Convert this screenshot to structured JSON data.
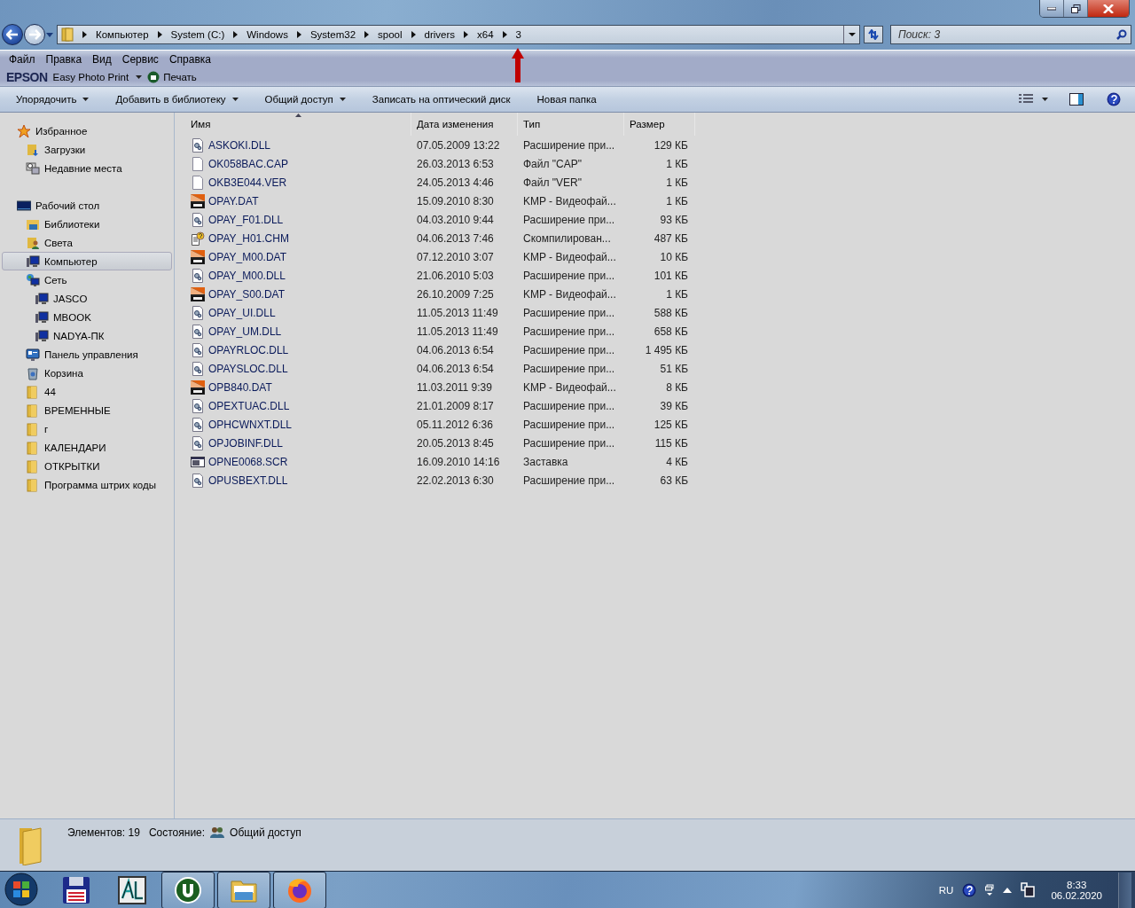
{
  "address_bar": {
    "path": [
      "Компьютер",
      "System (C:)",
      "Windows",
      "System32",
      "spool",
      "drivers",
      "x64",
      "3"
    ]
  },
  "search": {
    "placeholder": "Поиск: 3"
  },
  "menu": [
    "Файл",
    "Правка",
    "Вид",
    "Сервис",
    "Справка"
  ],
  "epson_bar": {
    "brand": "EPSON",
    "app": "Easy Photo Print",
    "print": "Печать"
  },
  "toolbar": [
    {
      "label": "Упорядочить",
      "dropdown": true
    },
    {
      "label": "Добавить в библиотеку",
      "dropdown": true
    },
    {
      "label": "Общий доступ",
      "dropdown": true
    },
    {
      "label": "Записать на оптический диск",
      "dropdown": false
    },
    {
      "label": "Новая папка",
      "dropdown": false
    }
  ],
  "sidebar": {
    "groups": [
      {
        "label": "Избранное",
        "kind": "star",
        "selected": false,
        "children": [
          {
            "label": "Загрузки",
            "kind": "downloads",
            "selected": false
          },
          {
            "label": "Недавние места",
            "kind": "recent",
            "selected": false
          }
        ]
      },
      {
        "label": "Рабочий стол",
        "kind": "desktop",
        "selected": false,
        "children": [
          {
            "label": "Библиотеки",
            "kind": "library",
            "selected": false
          },
          {
            "label": "Света",
            "kind": "user",
            "selected": false
          },
          {
            "label": "Компьютер",
            "kind": "computer",
            "selected": true
          },
          {
            "label": "Сеть",
            "kind": "network",
            "selected": false,
            "children": [
              {
                "label": "JASCO",
                "kind": "computer",
                "selected": false
              },
              {
                "label": "MBOOK",
                "kind": "computer",
                "selected": false
              },
              {
                "label": "NADYA-ПК",
                "kind": "computer",
                "selected": false
              }
            ]
          },
          {
            "label": "Панель управления",
            "kind": "control",
            "selected": false
          },
          {
            "label": "Корзина",
            "kind": "bin",
            "selected": false
          },
          {
            "label": "44",
            "kind": "folder",
            "selected": false
          },
          {
            "label": "ВРЕМЕННЫЕ",
            "kind": "folder",
            "selected": false
          },
          {
            "label": "г",
            "kind": "folder",
            "selected": false
          },
          {
            "label": "КАЛЕНДАРИ",
            "kind": "folder",
            "selected": false
          },
          {
            "label": "ОТКРЫТКИ",
            "kind": "folder",
            "selected": false
          },
          {
            "label": "Программа штрих коды",
            "kind": "folder",
            "selected": false
          }
        ]
      }
    ]
  },
  "table": {
    "columns": [
      "Имя",
      "Дата изменения",
      "Тип",
      "Размер"
    ],
    "rows": [
      {
        "kind": "dll",
        "name": "ASKOKI.DLL",
        "date": "07.05.2009 13:22",
        "type": "Расширение при...",
        "size": "129 КБ"
      },
      {
        "kind": "blank",
        "name": "OK058BAC.CAP",
        "date": "26.03.2013 6:53",
        "type": "Файл \"CAP\"",
        "size": "1 КБ"
      },
      {
        "kind": "blank",
        "name": "OKB3E044.VER",
        "date": "24.05.2013 4:46",
        "type": "Файл \"VER\"",
        "size": "1 КБ"
      },
      {
        "kind": "dat",
        "name": "OPAY.DAT",
        "date": "15.09.2010 8:30",
        "type": "KMP - Видеофай...",
        "size": "1 КБ"
      },
      {
        "kind": "dll",
        "name": "OPAY_F01.DLL",
        "date": "04.03.2010 9:44",
        "type": "Расширение при...",
        "size": "93 КБ"
      },
      {
        "kind": "chm",
        "name": "OPAY_H01.CHM",
        "date": "04.06.2013 7:46",
        "type": "Скомпилирован...",
        "size": "487 КБ"
      },
      {
        "kind": "dat",
        "name": "OPAY_M00.DAT",
        "date": "07.12.2010 3:07",
        "type": "KMP - Видеофай...",
        "size": "10 КБ"
      },
      {
        "kind": "dll",
        "name": "OPAY_M00.DLL",
        "date": "21.06.2010 5:03",
        "type": "Расширение при...",
        "size": "101 КБ"
      },
      {
        "kind": "dat",
        "name": "OPAY_S00.DAT",
        "date": "26.10.2009 7:25",
        "type": "KMP - Видеофай...",
        "size": "1 КБ"
      },
      {
        "kind": "dll",
        "name": "OPAY_UI.DLL",
        "date": "11.05.2013 11:49",
        "type": "Расширение при...",
        "size": "588 КБ"
      },
      {
        "kind": "dll",
        "name": "OPAY_UM.DLL",
        "date": "11.05.2013 11:49",
        "type": "Расширение при...",
        "size": "658 КБ"
      },
      {
        "kind": "dll",
        "name": "OPAYRLOC.DLL",
        "date": "04.06.2013 6:54",
        "type": "Расширение при...",
        "size": "1 495 КБ"
      },
      {
        "kind": "dll",
        "name": "OPAYSLOC.DLL",
        "date": "04.06.2013 6:54",
        "type": "Расширение при...",
        "size": "51 КБ"
      },
      {
        "kind": "dat",
        "name": "OPB840.DAT",
        "date": "11.03.2011 9:39",
        "type": "KMP - Видеофай...",
        "size": "8 КБ"
      },
      {
        "kind": "dll",
        "name": "OPEXTUAC.DLL",
        "date": "21.01.2009 8:17",
        "type": "Расширение при...",
        "size": "39 КБ"
      },
      {
        "kind": "dll",
        "name": "OPHCWNXT.DLL",
        "date": "05.11.2012 6:36",
        "type": "Расширение при...",
        "size": "125 КБ"
      },
      {
        "kind": "dll",
        "name": "OPJOBINF.DLL",
        "date": "20.05.2013 8:45",
        "type": "Расширение при...",
        "size": "115 КБ"
      },
      {
        "kind": "scr",
        "name": "OPNE0068.SCR",
        "date": "16.09.2010 14:16",
        "type": "Заставка",
        "size": "4 КБ"
      },
      {
        "kind": "dll",
        "name": "OPUSBEXT.DLL",
        "date": "22.02.2013 6:30",
        "type": "Расширение при...",
        "size": "63 КБ"
      }
    ]
  },
  "status_bar": {
    "count": "Элементов: 19",
    "state_label": "Состояние:",
    "state": "Общий доступ"
  },
  "taskbar": {
    "apps": [
      {
        "kind": "floppy",
        "active": false
      },
      {
        "kind": "al",
        "active": false
      },
      {
        "kind": "torrent",
        "active": true
      },
      {
        "kind": "explorer",
        "active": true
      },
      {
        "kind": "firefox",
        "active": true
      }
    ],
    "language": "RU",
    "time": "8:33",
    "date": "06.02.2020"
  }
}
